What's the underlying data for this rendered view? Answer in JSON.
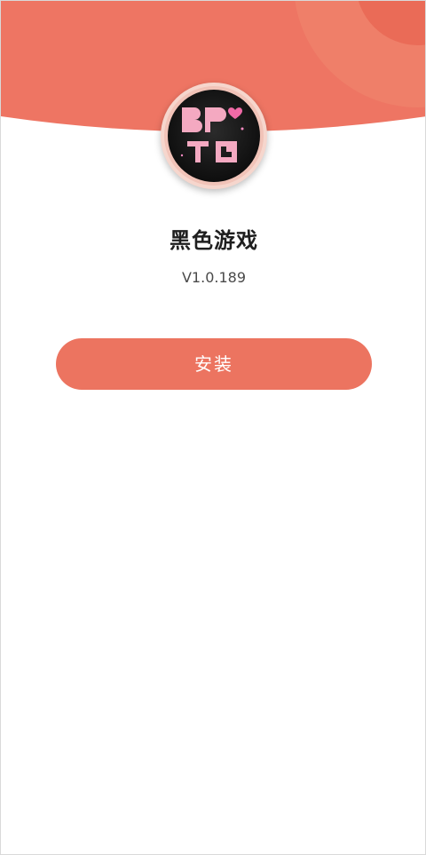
{
  "app": {
    "name": "黑色游戏",
    "version": "V1.0.189",
    "logo_text": "BPTG",
    "logo_icon": "app-logo"
  },
  "actions": {
    "install_label": "安装"
  },
  "colors": {
    "accent": "#ec7460",
    "header_bg": "#ee7563",
    "header_circle": "#f08a74",
    "logo_bg": "#121212",
    "logo_letters": "#f3a6c0"
  }
}
